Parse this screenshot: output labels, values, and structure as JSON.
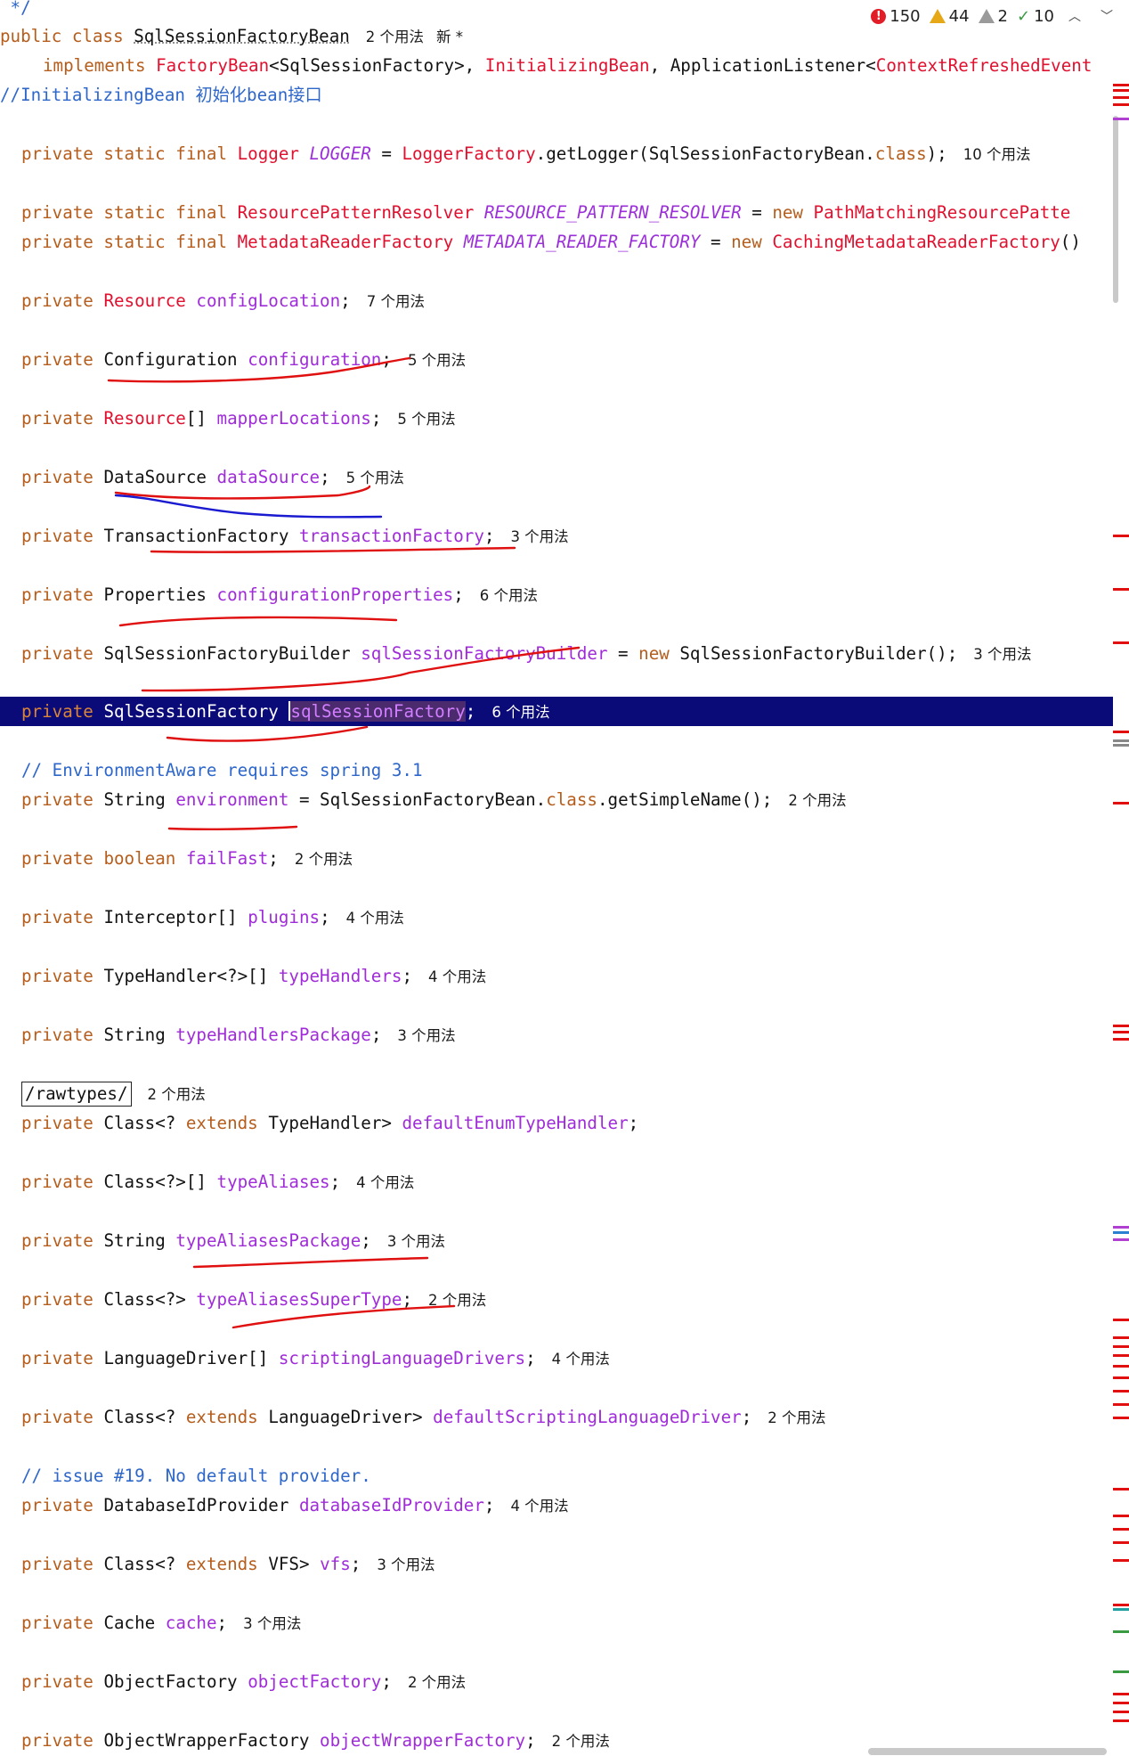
{
  "status": {
    "errors": "150",
    "warnings": "44",
    "weak_warnings": "2",
    "typos": "10",
    "prev_icon": "chevron-up-icon",
    "next_icon": "chevron-down-icon"
  },
  "code": {
    "comment_end": " */",
    "class_decl": {
      "kw_public": "public",
      "kw_class": "class",
      "name": "SqlSessionFactoryBean",
      "usages": "2 个用法",
      "new_label": "新 *"
    },
    "implements_line": {
      "kw": "implements",
      "t1": "FactoryBean",
      "t1_arg": "<SqlSessionFactory>,",
      "t2": "InitializingBean",
      "sep": ",",
      "t3": "ApplicationListener<",
      "t4": "ContextRefreshedEvent"
    },
    "comment_init": "//InitializingBean 初始化bean接口",
    "logger": {
      "kw": "private static final",
      "type": "Logger",
      "name": "LOGGER",
      "eq": " = ",
      "factory": "LoggerFactory",
      "rest": ".getLogger(SqlSessionFactoryBean.",
      "kw_class": "class",
      "end": ");",
      "usages": "10 个用法"
    },
    "resolver": {
      "kw": "private static final",
      "type": "ResourcePatternResolver",
      "name": "RESOURCE_PATTERN_RESOLVER",
      "eq": " = ",
      "kw_new": "new",
      "ctor": "PathMatchingResourcePatte"
    },
    "reader": {
      "kw": "private static final",
      "type": "MetadataReaderFactory",
      "name": "METADATA_READER_FACTORY",
      "eq": " = ",
      "kw_new": "new",
      "ctor": "CachingMetadataReaderFactory",
      "end": "()"
    },
    "fields": [
      {
        "kw": "private",
        "type": "Resource",
        "type_red": true,
        "name": "configLocation",
        "end": ";",
        "usages": "7 个用法"
      },
      {
        "kw": "private",
        "type": "Configuration",
        "name": "configuration",
        "end": ";",
        "usages": "5 个用法"
      },
      {
        "kw": "private",
        "type": "Resource",
        "type_red": true,
        "suffix": "[]",
        "name": "mapperLocations",
        "end": ";",
        "usages": "5 个用法"
      },
      {
        "kw": "private",
        "type": "DataSource",
        "name": "dataSource",
        "end": ";",
        "usages": "5 个用法"
      },
      {
        "kw": "private",
        "type": "TransactionFactory",
        "name": "transactionFactory",
        "end": ";",
        "usages": "3 个用法"
      },
      {
        "kw": "private",
        "type": "Properties",
        "name": "configurationProperties",
        "end": ";",
        "usages": "6 个用法"
      }
    ],
    "builder": {
      "kw": "private",
      "type": "SqlSessionFactoryBuilder",
      "name": "sqlSessionFactoryBuilder",
      "eq": " = ",
      "kw_new": "new",
      "ctor": "SqlSessionFactoryBuilder();",
      "usages": "3 个用法"
    },
    "session_factory": {
      "kw": "private",
      "type": "SqlSessionFactory",
      "name": "sqlSessionFactory",
      "end": ";",
      "usages": "6 个用法"
    },
    "comment_env": "// EnvironmentAware requires spring 3.1",
    "environment": {
      "kw": "private",
      "type": "String",
      "name": "environment",
      "eq": " = ",
      "rest": "SqlSessionFactoryBean.",
      "kw_class": "class",
      "end": ".getSimpleName();",
      "usages": "2 个用法"
    },
    "fields2": [
      {
        "kw": "private",
        "type": "boolean",
        "type_kw": true,
        "name": "failFast",
        "end": ";",
        "usages": "2 个用法"
      },
      {
        "kw": "private",
        "type": "Interceptor[]",
        "name": "plugins",
        "end": ";",
        "usages": "4 个用法"
      },
      {
        "kw": "private",
        "type": "TypeHandler<?>[]",
        "name": "typeHandlers",
        "end": ";",
        "usages": "4 个用法"
      },
      {
        "kw": "private",
        "type": "String",
        "name": "typeHandlersPackage",
        "end": ";",
        "usages": "3 个用法"
      }
    ],
    "annotation": {
      "text": "/rawtypes/",
      "usages": "2 个用法"
    },
    "enum_handler": {
      "kw": "private",
      "type_a": "Class<?",
      "kw_ext": "extends",
      "type_b": "TypeHandler>",
      "name": "defaultEnumTypeHandler",
      "end": ";"
    },
    "fields3": [
      {
        "kw": "private",
        "type": "Class<?>[]",
        "name": "typeAliases",
        "end": ";",
        "usages": "4 个用法"
      },
      {
        "kw": "private",
        "type": "String",
        "name": "typeAliasesPackage",
        "end": ";",
        "usages": "3 个用法"
      },
      {
        "kw": "private",
        "type": "Class<?>",
        "name": "typeAliasesSuperType",
        "end": ";",
        "usages": "2 个用法"
      },
      {
        "kw": "private",
        "type": "LanguageDriver[]",
        "name": "scriptingLanguageDrivers",
        "end": ";",
        "usages": "4 个用法"
      }
    ],
    "lang_driver": {
      "kw": "private",
      "type_a": "Class<?",
      "kw_ext": "extends",
      "type_b": "LanguageDriver>",
      "name": "defaultScriptingLanguageDriver",
      "end": ";",
      "usages": "2 个用法"
    },
    "comment_issue": "// issue #19. No default provider.",
    "db_provider": {
      "kw": "private",
      "type": "DatabaseIdProvider",
      "name": "databaseIdProvider",
      "end": ";",
      "usages": "4 个用法"
    },
    "vfs": {
      "kw": "private",
      "type_a": "Class<?",
      "kw_ext": "extends",
      "type_b": "VFS>",
      "name": "vfs",
      "end": ";",
      "usages": "3 个用法"
    },
    "fields4": [
      {
        "kw": "private",
        "type": "Cache",
        "name": "cache",
        "end": ";",
        "usages": "3 个用法"
      },
      {
        "kw": "private",
        "type": "ObjectFactory",
        "name": "objectFactory",
        "end": ";",
        "usages": "2 个用法"
      },
      {
        "kw": "private",
        "type": "ObjectWrapperFactory",
        "name": "objectWrapperFactory",
        "end": ";",
        "usages": "2 个用法"
      }
    ]
  },
  "colors": {
    "keyword": "#b55d1c",
    "type_red": "#e0102f",
    "field": "#9f2cd8",
    "comment": "#2e67c9",
    "selection_line": "#0a0a78",
    "annotation_red": "#e01010",
    "annotation_blue": "#1a1ad0"
  }
}
